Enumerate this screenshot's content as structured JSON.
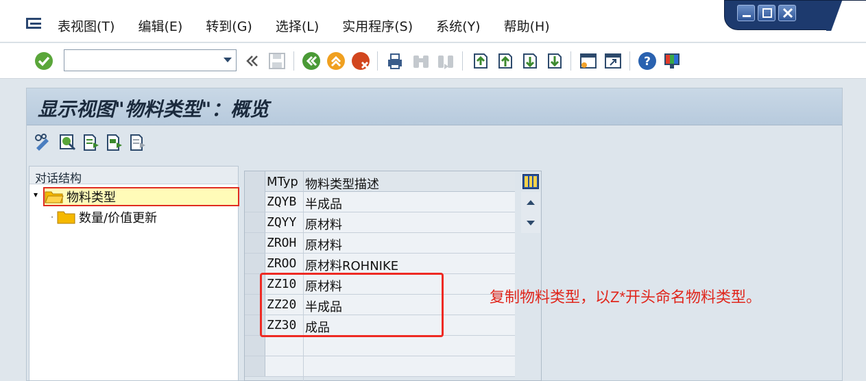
{
  "menubar": {
    "items": [
      {
        "label": "表视图(T)"
      },
      {
        "label": "编辑(E)"
      },
      {
        "label": "转到(G)"
      },
      {
        "label": "选择(L)"
      },
      {
        "label": "实用程序(S)"
      },
      {
        "label": "系统(Y)"
      },
      {
        "label": "帮助(H)"
      }
    ]
  },
  "toolbar": {
    "command_field": {
      "value": "",
      "placeholder": ""
    }
  },
  "screen": {
    "title": "显示视图\"物料类型\"：概览"
  },
  "tree": {
    "header": "对话结构",
    "nodes": [
      {
        "label": "物料类型",
        "selected": true
      },
      {
        "label": "数量/价值更新",
        "selected": false
      }
    ]
  },
  "table": {
    "headers": {
      "mtyp": "MTyp",
      "desc": "物料类型描述"
    },
    "rows": [
      {
        "mtyp": "ZQYB",
        "desc": "半成品"
      },
      {
        "mtyp": "ZQYY",
        "desc": "原材料"
      },
      {
        "mtyp": "ZROH",
        "desc": "原材料"
      },
      {
        "mtyp": "ZROO",
        "desc": "原材料ROHNIKE"
      },
      {
        "mtyp": "ZZ10",
        "desc": "原材料"
      },
      {
        "mtyp": "ZZ20",
        "desc": "半成品"
      },
      {
        "mtyp": "ZZ30",
        "desc": "成品"
      },
      {
        "mtyp": "",
        "desc": ""
      },
      {
        "mtyp": "",
        "desc": ""
      }
    ]
  },
  "annotation": {
    "text": "复制物料类型，以Z*开头命名物料类型。",
    "color": "#e0261c"
  },
  "colors": {
    "title_bar": "#b7cadd",
    "annotation_red": "#ee2a23",
    "selection_fill": "#fffbb8"
  }
}
